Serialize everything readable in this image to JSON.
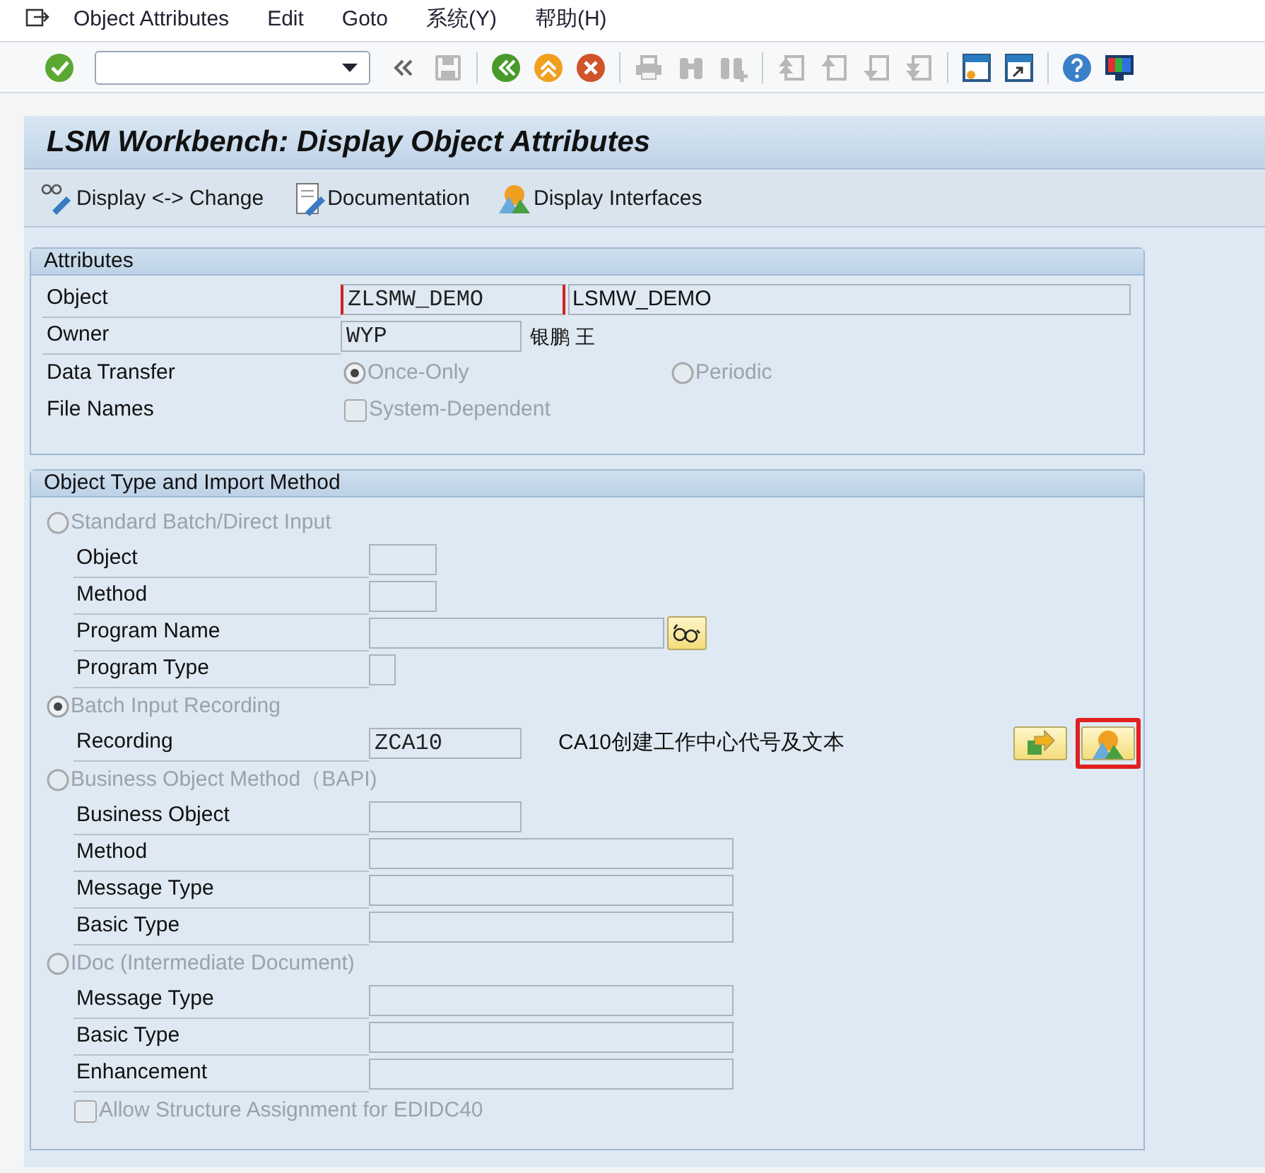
{
  "menu_bar": {
    "items": [
      {
        "label": "Object Attributes"
      },
      {
        "label": "Edit"
      },
      {
        "label": "Goto"
      },
      {
        "label": "系统(Y)"
      },
      {
        "label": "帮助(H)"
      }
    ]
  },
  "toolbar": {
    "buttons": [
      {
        "kind": "enter",
        "disabled": false
      },
      {
        "kind": "command"
      },
      {
        "kind": "collapse",
        "disabled": false
      },
      {
        "kind": "save",
        "disabled": true
      },
      {
        "kind": "sep"
      },
      {
        "kind": "back",
        "disabled": false
      },
      {
        "kind": "exit",
        "disabled": false
      },
      {
        "kind": "cancel",
        "disabled": false
      },
      {
        "kind": "sep"
      },
      {
        "kind": "print",
        "disabled": true
      },
      {
        "kind": "find",
        "disabled": true
      },
      {
        "kind": "findnext",
        "disabled": true
      },
      {
        "kind": "sep"
      },
      {
        "kind": "first",
        "disabled": true
      },
      {
        "kind": "prev",
        "disabled": true
      },
      {
        "kind": "next",
        "disabled": true
      },
      {
        "kind": "last",
        "disabled": true
      },
      {
        "kind": "sep"
      },
      {
        "kind": "session",
        "disabled": false
      },
      {
        "kind": "shortcut",
        "disabled": false
      },
      {
        "kind": "sep"
      },
      {
        "kind": "help",
        "disabled": false
      },
      {
        "kind": "layout",
        "disabled": false
      }
    ]
  },
  "title": "LSM Workbench: Display Object Attributes",
  "app_toolbar": [
    {
      "kind": "toggle",
      "label": "Display <-> Change"
    },
    {
      "kind": "doc",
      "label": "Documentation"
    },
    {
      "kind": "interfaces",
      "label": "Display Interfaces"
    }
  ],
  "attributes": {
    "title": "Attributes",
    "rows": [
      {
        "kind": "field",
        "label": "Object",
        "value": "ZLSMW_DEMO",
        "focused": true,
        "description": "LSMW_DEMO",
        "description_boxed": true
      },
      {
        "kind": "field",
        "label": "Owner",
        "value": "WYP",
        "focused": false,
        "description": "银鹏 王",
        "description_boxed": false
      },
      {
        "kind": "radio",
        "label": "Data Transfer",
        "options": [
          {
            "label": "Once-Only",
            "selected": true,
            "disabled": true
          },
          {
            "label": "Periodic",
            "selected": false,
            "disabled": true
          }
        ]
      },
      {
        "kind": "checkbox",
        "label": "File Names",
        "option": {
          "label": "System-Dependent",
          "checked": false,
          "disabled": true
        }
      }
    ]
  },
  "import_method": {
    "title": "Object Type and Import Method",
    "options": [
      {
        "label": "Standard Batch/Direct Input",
        "selected": false,
        "disabled": true,
        "fields": [
          {
            "label": "Object"
          },
          {
            "label": "Method"
          },
          {
            "label": "Program Name",
            "button": true
          },
          {
            "label": "Program Type"
          }
        ]
      },
      {
        "label": "Batch Input Recording",
        "selected": true,
        "disabled": true,
        "fields": [
          {
            "label": "Recording",
            "value": "ZCA10",
            "description": "CA10创建工作中心代号及文本",
            "buttons": [
              {
                "kind": "goto",
                "highlighted": false
              },
              {
                "kind": "interfaces",
                "highlighted": true
              }
            ]
          }
        ]
      },
      {
        "label": "Business Object Method（BAPI)",
        "selected": false,
        "disabled": true,
        "fields": [
          {
            "label": "Business Object"
          },
          {
            "label": "Method"
          },
          {
            "label": "Message Type"
          },
          {
            "label": "Basic Type"
          }
        ]
      },
      {
        "label": "IDoc (Intermediate Document)",
        "selected": false,
        "disabled": true,
        "fields": [
          {
            "label": "Message Type"
          },
          {
            "label": "Basic Type"
          },
          {
            "label": "Enhancement"
          }
        ],
        "checkbox": {
          "label": "Allow Structure Assignment for EDIDC40",
          "checked": false,
          "disabled": true
        }
      }
    ]
  }
}
